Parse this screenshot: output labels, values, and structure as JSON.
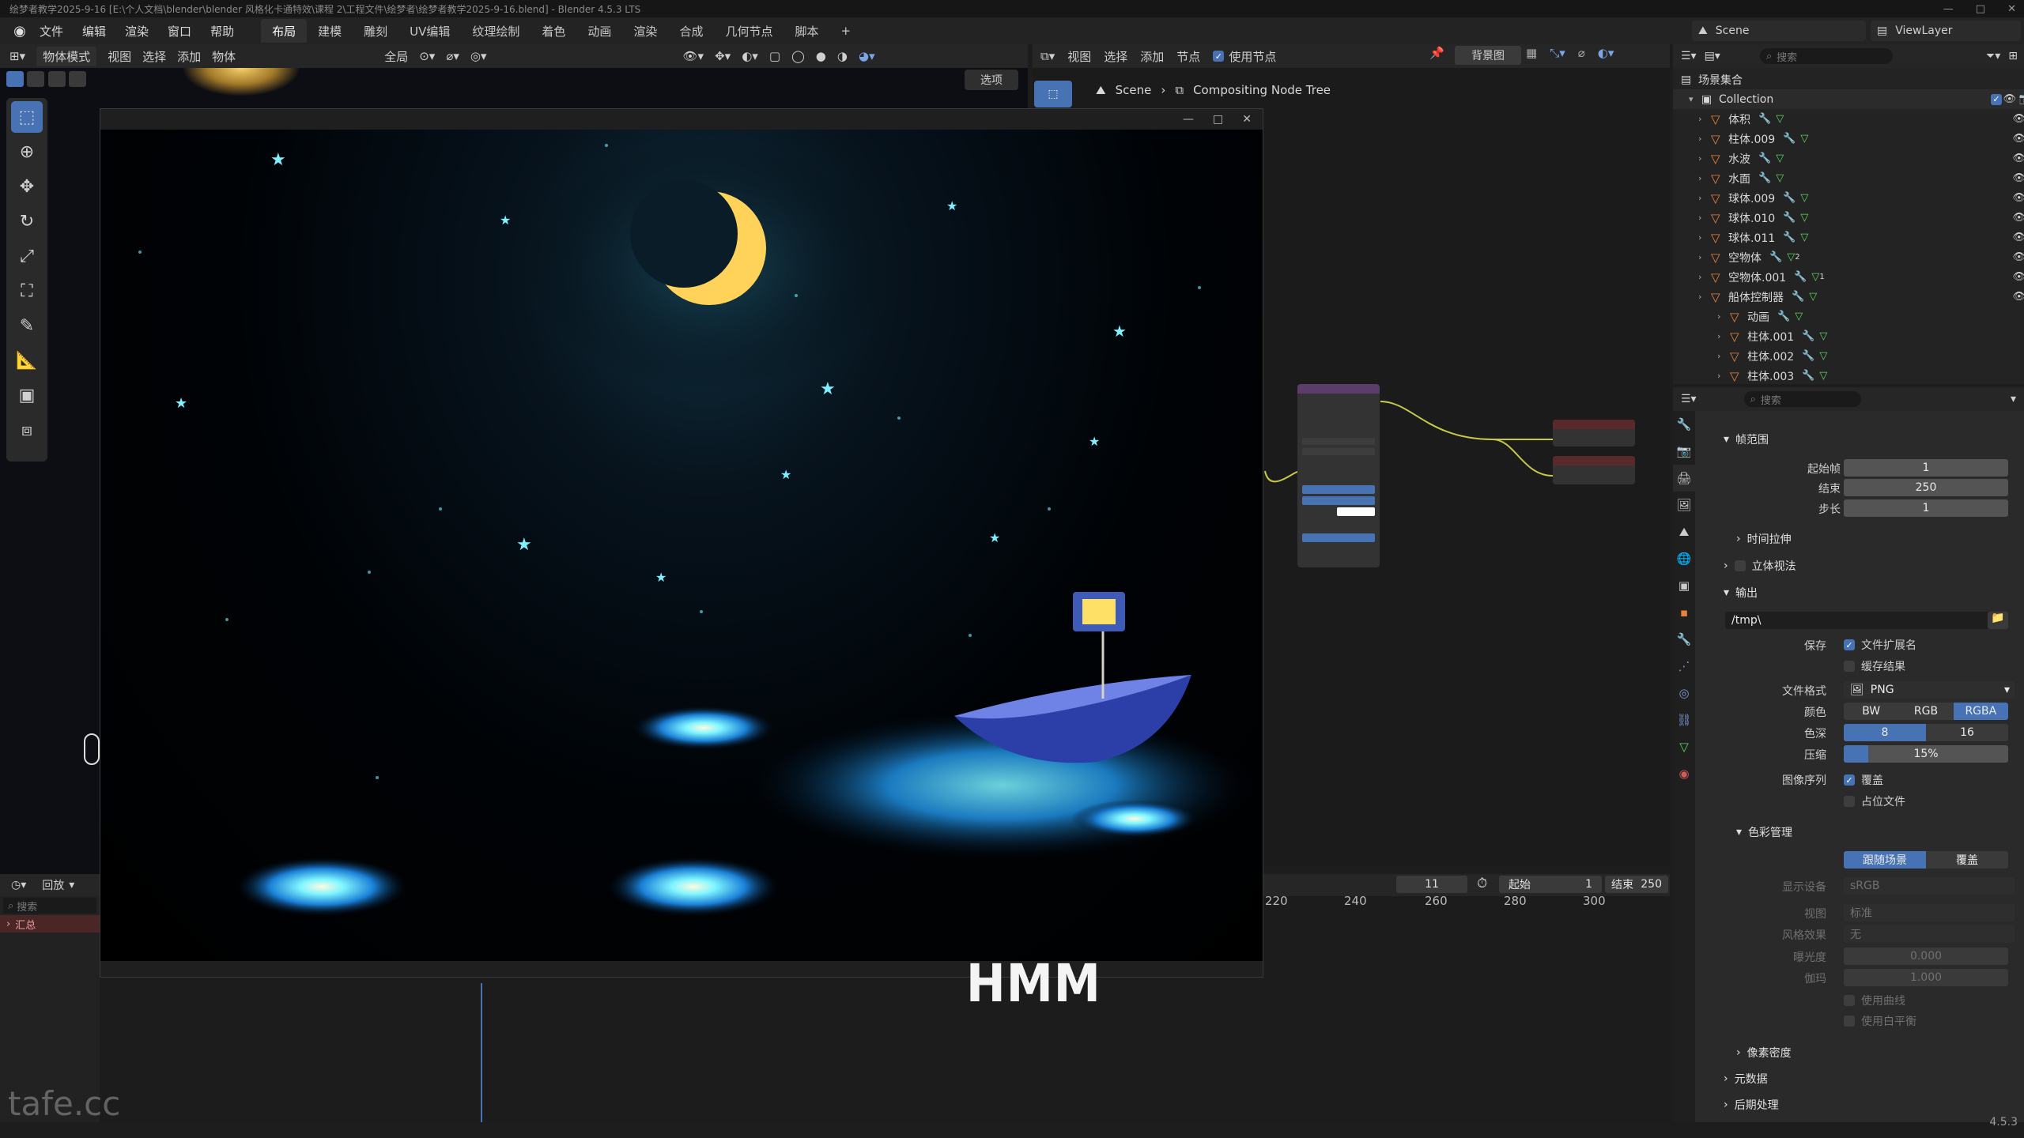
{
  "window": {
    "title": "绘梦者教学2025-9-16 [E:\\个人文档\\blender\\blender 风格化卡通特效\\课程 2\\工程文件\\绘梦者\\绘梦者教学2025-9-16.blend] - Blender 4.5.3 LTS",
    "controls": [
      "—",
      "□",
      "✕"
    ]
  },
  "menubar": {
    "menus": [
      "文件",
      "编辑",
      "渲染",
      "窗口",
      "帮助"
    ],
    "workspaces": [
      "布局",
      "建模",
      "雕刻",
      "UV编辑",
      "纹理绘制",
      "着色",
      "动画",
      "渲染",
      "合成",
      "几何节点",
      "脚本"
    ],
    "active_workspace": "布局",
    "scene": "Scene",
    "view_layer": "ViewLayer"
  },
  "viewport": {
    "mode": "物体模式",
    "menus": [
      "视图",
      "选择",
      "添加",
      "物体"
    ],
    "transform": "全局",
    "options": "选项"
  },
  "render_window": {
    "controls": [
      "—",
      "□",
      "✕"
    ]
  },
  "node_editor": {
    "menus": [
      "视图",
      "选择",
      "添加",
      "节点"
    ],
    "use_nodes": "使用节点",
    "backdrop": "背景图",
    "breadcrumb": [
      "Scene",
      "Compositing Node Tree"
    ]
  },
  "timeline": {
    "playback": "回放",
    "current_frame": "11",
    "start_label": "起始",
    "start": "1",
    "end_label": "结束",
    "end": "250",
    "ticks": [
      "220",
      "240",
      "260",
      "280",
      "300"
    ],
    "search_placeholder": "搜索",
    "summary": "汇总"
  },
  "outliner": {
    "root": "场景集合",
    "search_placeholder": "搜索",
    "collection": "Collection",
    "items": [
      {
        "name": "体积",
        "indent": 1
      },
      {
        "name": "柱体.009",
        "indent": 1
      },
      {
        "name": "水波",
        "indent": 1
      },
      {
        "name": "水面",
        "indent": 1
      },
      {
        "name": "球体.009",
        "indent": 1
      },
      {
        "name": "球体.010",
        "indent": 1
      },
      {
        "name": "球体.011",
        "indent": 1
      },
      {
        "name": "空物体",
        "indent": 1,
        "badge": "2"
      },
      {
        "name": "空物体.001",
        "indent": 1,
        "badge": "1"
      },
      {
        "name": "船体控制器",
        "indent": 1
      },
      {
        "name": "动画",
        "indent": 2
      },
      {
        "name": "柱体.001",
        "indent": 2
      },
      {
        "name": "柱体.002",
        "indent": 2
      },
      {
        "name": "柱体.003",
        "indent": 2
      }
    ]
  },
  "properties": {
    "search_placeholder": "搜索",
    "frame_range": {
      "title": "帧范围",
      "start_label": "起始帧",
      "start": "1",
      "end_label": "结束",
      "end": "250",
      "step_label": "步长",
      "step": "1"
    },
    "time_stretch": "时间拉伸",
    "stereoscopy": "立体视法",
    "output": {
      "title": "输出",
      "path": "/tmp\\",
      "save_label": "保存",
      "file_ext": "文件扩展名",
      "cache": "缓存结果",
      "format_label": "文件格式",
      "format": "PNG",
      "color_label": "颜色",
      "color_opts": [
        "BW",
        "RGB",
        "RGBA"
      ],
      "color_active": "RGBA",
      "depth_label": "色深",
      "depth_opts": [
        "8",
        "16"
      ],
      "compression_label": "压缩",
      "compression": "15%",
      "compression_value": 0.15,
      "sequence_label": "图像序列",
      "overwrite": "覆盖",
      "placeholders": "占位文件"
    },
    "color_management": {
      "title": "色彩管理",
      "follow_scene": "跟随场景",
      "override": "覆盖",
      "display_label": "显示设备",
      "display": "sRGB",
      "view_label": "视图",
      "view": "标准",
      "look_label": "风格效果",
      "look": "无",
      "exposure_label": "曝光度",
      "exposure": "0.000",
      "gamma_label": "伽玛",
      "gamma": "1.000",
      "use_curves": "使用曲线",
      "use_white_balance": "使用白平衡"
    },
    "pixel_density": "像素密度",
    "metadata": "元数据",
    "post_processing": "后期处理"
  },
  "overlay": {
    "subtitle": "HMM",
    "watermark": "tafe.cc"
  },
  "version": "4.5.3"
}
